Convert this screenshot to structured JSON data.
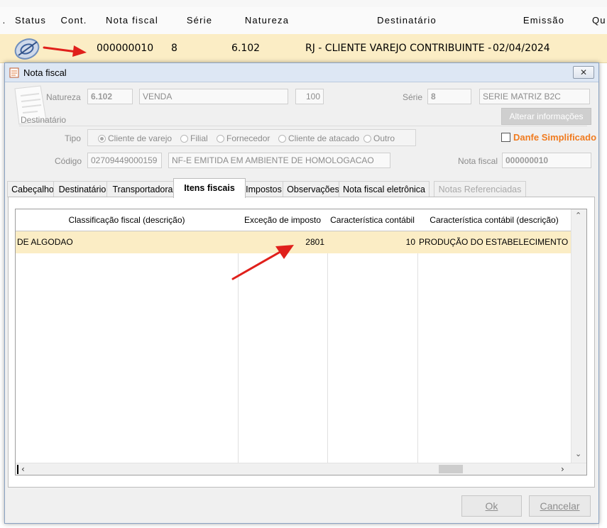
{
  "background_grid": {
    "headers": [
      "Status",
      "Cont.",
      "Nota fiscal",
      "Série",
      "Natureza",
      "Destinatário",
      "Emissão",
      "Qu"
    ],
    "row": {
      "nota_fiscal": "000000010",
      "serie": "8",
      "natureza": "6.102",
      "destinatario": "RJ - CLIENTE VAREJO CONTRIBUINTE - LOJA",
      "emissao": "02/04/2024"
    }
  },
  "dialog": {
    "title": "Nota fiscal",
    "close_label": "✕",
    "fields": {
      "natureza_label": "Natureza",
      "natureza_code": "6.102",
      "natureza_desc": "VENDA",
      "natureza_num": "100",
      "serie_label": "Série",
      "serie_code": "8",
      "serie_desc": "SERIE MATRIZ B2C",
      "destinatario_label": "Destinatário",
      "alterar_button": "Alterar informações",
      "tipo_label": "Tipo",
      "tipo_options": [
        "Cliente de varejo",
        "Filial",
        "Fornecedor",
        "Cliente de atacado",
        "Outro"
      ],
      "danfe_label": "Danfe Simplificado",
      "codigo_label": "Código",
      "codigo_value": "02709449000159",
      "codigo_desc": "NF-E EMITIDA EM AMBIENTE DE HOMOLOGACAO",
      "nota_fiscal_label": "Nota fiscal",
      "nota_fiscal_value": "000000010"
    },
    "tabs": [
      "Cabeçalho",
      "Destinatário",
      "Transportadora",
      "Itens fiscais",
      "Impostos",
      "Observações",
      "Nota fiscal eletrônica",
      "Notas Referenciadas"
    ],
    "active_tab": "Itens fiscais",
    "items_table": {
      "columns": [
        "Classificação fiscal (descrição)",
        "Exceção de imposto",
        "Característica contábil",
        "Característica contábil (descrição)"
      ],
      "rows": [
        [
          "DE ALGODAO",
          "2801",
          "10",
          "PRODUÇÃO DO ESTABELECIMENTO"
        ]
      ]
    },
    "ok_button": "Ok",
    "cancel_button": "Cancelar"
  },
  "colors": {
    "row_highlight": "#fbedc5",
    "annotation_arrow": "#e0201b",
    "danfe_orange": "#f07b1f"
  }
}
